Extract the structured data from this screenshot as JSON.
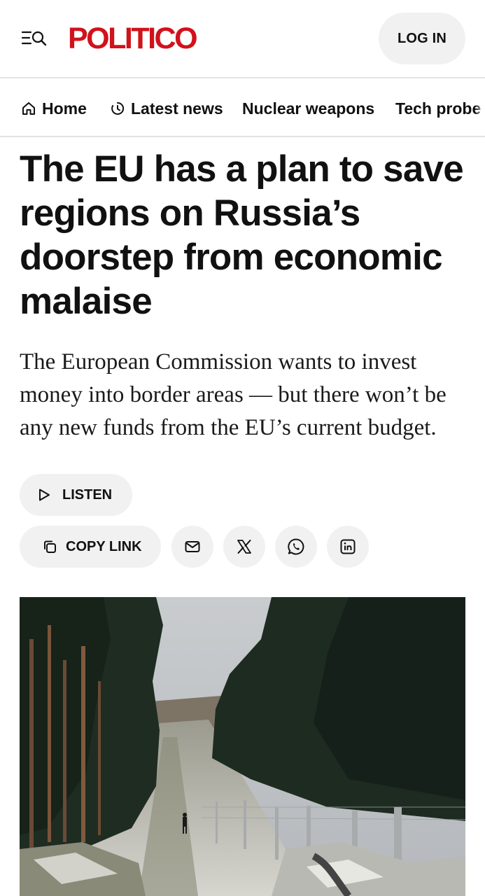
{
  "header": {
    "logo": "POLITICO",
    "logo_color": "#d0121c",
    "menu_icon": "menu-search-icon",
    "login_label": "LOG IN"
  },
  "nav": {
    "items": [
      {
        "label": "Home",
        "icon": "home-icon"
      },
      {
        "label": "Latest news",
        "icon": "clock-icon"
      },
      {
        "label": "Nuclear weapons"
      },
      {
        "label": "Tech probe"
      }
    ]
  },
  "article": {
    "headline": "The EU has a plan to save regions on Russia’s doorstep from economic malaise",
    "dek": "The European Commission wants to invest money into border areas — but there won’t be any new funds from the EU’s current budget.",
    "listen_label": "LISTEN",
    "copy_link_label": "COPY LINK",
    "share_icons": [
      "email-icon",
      "x-icon",
      "whatsapp-icon",
      "linkedin-icon"
    ]
  },
  "colors": {
    "pill_background": "#f1f1f1",
    "divider": "#e3e3e3",
    "text": "#111111"
  }
}
